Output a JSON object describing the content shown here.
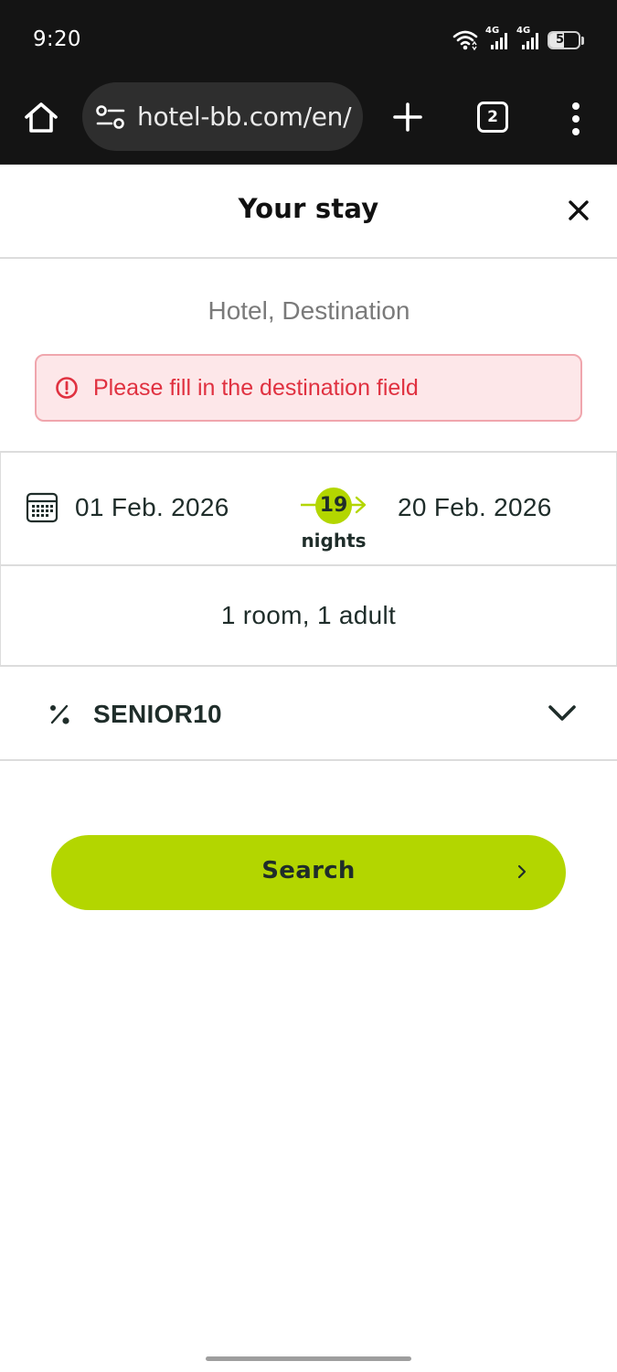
{
  "status_bar": {
    "time": "9:20",
    "network_labels": [
      "4G",
      "4G"
    ],
    "battery": "51",
    "battery_level": 0.51,
    "icons": [
      "wifi-icon",
      "signal-icon",
      "signal-icon",
      "battery-icon"
    ]
  },
  "browser": {
    "url": "hotel-bb.com/en/",
    "tab_count": "2",
    "icons": [
      "home-icon",
      "site-settings-icon",
      "new-tab-icon",
      "tabs-icon",
      "overflow-menu-icon"
    ]
  },
  "header": {
    "title": "Your stay",
    "close_icon": "close-icon"
  },
  "destination": {
    "placeholder": "Hotel, Destination",
    "value": "",
    "error": "Please fill in the destination field",
    "error_icon": "alert-circle-icon"
  },
  "dates": {
    "check_in": "01 Feb. 2026",
    "check_out": "20 Feb. 2026",
    "nights": "19",
    "nights_label": "nights",
    "icon": "calendar-icon"
  },
  "guests": {
    "summary": "1 room, 1 adult"
  },
  "promo": {
    "code": "SENIOR10",
    "icon": "percent-icon",
    "toggle_icon": "chevron-down-icon"
  },
  "search": {
    "label": "Search",
    "icon": "chevron-right-icon"
  },
  "colors": {
    "accent": "#b3d600",
    "text": "#1f2d2a",
    "error_text": "#e03140",
    "error_bg": "#fde7e9",
    "error_border": "#f0a6ad",
    "browser_bg": "#141414"
  }
}
